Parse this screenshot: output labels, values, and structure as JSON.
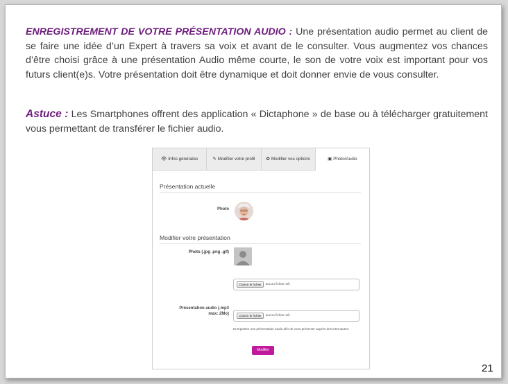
{
  "paragraph1": {
    "lead": "ENREGISTREMENT DE VOTRE PRÉSENTATION AUDIO :",
    "text": " Une présentation audio permet au client de se faire une idée d’un Expert à travers sa voix et avant de le consulter. Vous augmentez vos chances d’être choisi grâce à une présentation Audio même courte, le son de votre voix est important pour vos futurs client(e)s. Votre présentation doit être dynamique et doit donner envie de vous consulter."
  },
  "paragraph2": {
    "lead": "Astuce :",
    "text": " Les Smartphones offrent des application « Dictaphone » de base ou à télécharger gratuitement vous permettant de transférer le fichier audio."
  },
  "screenshot": {
    "tabs": [
      {
        "icon": "eye-icon",
        "glyph": "👁",
        "label": "Infos générales"
      },
      {
        "icon": "edit-icon",
        "glyph": "✎",
        "label": "Modifier votre profil"
      },
      {
        "icon": "gear-icon",
        "glyph": "✿",
        "label": "Modifier vos options"
      },
      {
        "icon": "picture-icon",
        "glyph": "▣",
        "label": "Photo/Audio"
      }
    ],
    "current_section_title": "Présentation actuelle",
    "photo_label": "Photo",
    "edit_section_title": "Modifier votre présentation",
    "photo_upload_label": "Photo (.jpg .png .gif)",
    "file_button_label": "Choisir le fichier",
    "no_file_text": "aucun fichier sél.",
    "audio_label_line1": "Présentation audio (.mp3",
    "audio_label_line2": "max: 2Mo)",
    "audio_help": "Enregistrez une présentation audio afin de vous présenter auprès des internautes.",
    "submit_label": "Modifier",
    "accent_color": "#c0199b"
  },
  "page_number": "21"
}
